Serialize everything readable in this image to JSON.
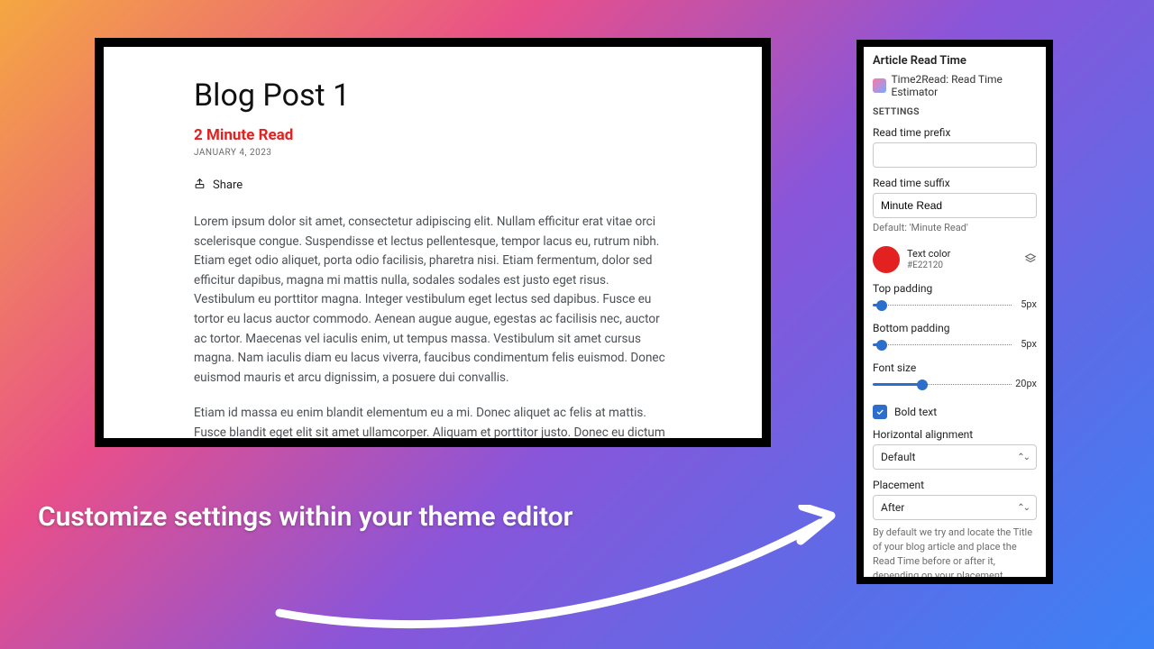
{
  "blog": {
    "title": "Blog Post 1",
    "read_time": "2 Minute Read",
    "date": "JANUARY 4, 2023",
    "share_label": "Share",
    "paragraph1": "Lorem ipsum dolor sit amet, consectetur adipiscing elit. Nullam efficitur erat vitae orci scelerisque congue. Suspendisse et lectus pellentesque, tempor lacus eu, rutrum nibh. Etiam eget odio aliquet, porta odio facilisis, pharetra nisi. Etiam fermentum, dolor sed efficitur dapibus, magna mi mattis nulla, sodales sodales est justo eget risus. Vestibulum eu porttitor magna. Integer vestibulum eget lectus sed dapibus. Fusce eu tortor eu lacus auctor commodo. Aenean augue augue, egestas ac facilisis nec, auctor ac tortor. Maecenas vel iaculis enim, ut tempus massa. Vestibulum sit amet cursus magna. Nam iaculis diam eu lacus viverra, faucibus condimentum felis euismod. Donec euismod mauris et arcu dignissim, a posuere dui convallis.",
    "paragraph2": "Etiam id massa eu enim blandit elementum eu a mi. Donec aliquet ac felis at mattis. Fusce blandit eget elit sit amet ullamcorper. Aliquam et porttitor justo. Donec eu dictum risus. Phasellus luctus nisl fringilla ultrices dictum. Nunc rhoncus magna id erat fringilla venenatis. Praesent quis ligula dictum massa tristique gravida quis dignissim eros. Fusce dictum arcu eu lacus tristique rhoncus. Nunc lacus"
  },
  "panel": {
    "title": "Article Read Time",
    "app_name": "Time2Read: Read Time Estimator",
    "section": "SETTINGS",
    "prefix_label": "Read time prefix",
    "prefix_value": "",
    "suffix_label": "Read time suffix",
    "suffix_value": "Minute Read",
    "suffix_hint": "Default: 'Minute Read'",
    "color_label": "Text color",
    "color_value": "#E22120",
    "top_padding_label": "Top padding",
    "top_padding_value": "5px",
    "bottom_padding_label": "Bottom padding",
    "bottom_padding_value": "5px",
    "font_size_label": "Font size",
    "font_size_value": "20px",
    "bold_label": "Bold text",
    "bold_checked": true,
    "halign_label": "Horizontal alignment",
    "halign_value": "Default",
    "placement_label": "Placement",
    "placement_value": "After",
    "placement_help": "By default we try and locate the Title of your blog article and place the Read Time before or after it, depending on your placement selection here."
  },
  "caption": "Customize settings within your theme editor"
}
